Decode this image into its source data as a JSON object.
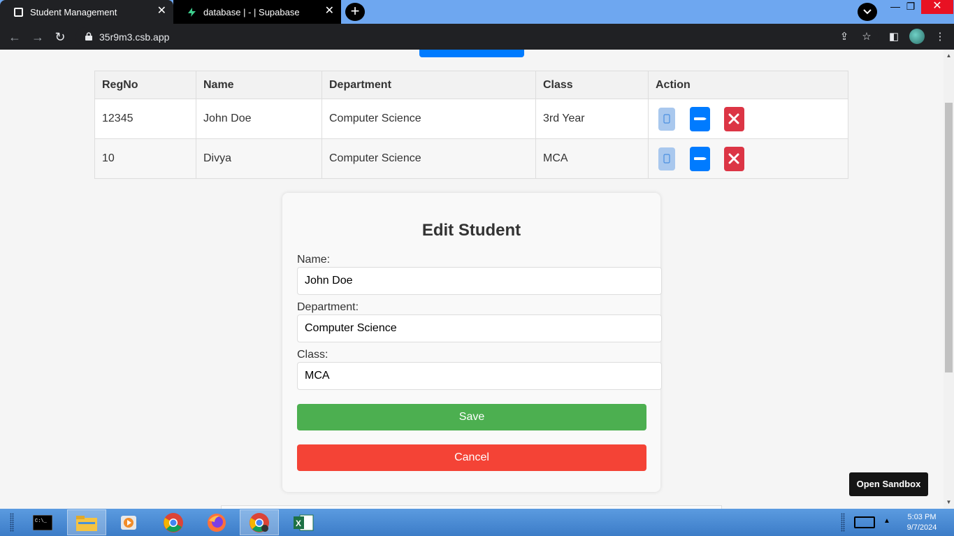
{
  "browser": {
    "tabs": [
      {
        "title": "Student Management",
        "active": true
      },
      {
        "title": "database | - | Supabase",
        "active": false
      }
    ],
    "url": "35r9m3.csb.app"
  },
  "table": {
    "headers": [
      "RegNo",
      "Name",
      "Department",
      "Class",
      "Action"
    ],
    "rows": [
      {
        "regno": "12345",
        "name": "John Doe",
        "department": "Computer Science",
        "class": "3rd Year"
      },
      {
        "regno": "10",
        "name": "Divya",
        "department": "Computer Science",
        "class": "MCA"
      }
    ]
  },
  "form": {
    "title": "Edit Student",
    "name_label": "Name:",
    "name_value": "John Doe",
    "department_label": "Department:",
    "department_value": "Computer Science",
    "class_label": "Class:",
    "class_value": "MCA",
    "save_label": "Save",
    "cancel_label": "Cancel"
  },
  "sandbox_button": "Open Sandbox",
  "taskbar": {
    "time": "5:03 PM",
    "date": "9/7/2024"
  },
  "colors": {
    "edit": "#007bff",
    "delete": "#dc3545",
    "save": "#4caf50",
    "cancel": "#f44336"
  }
}
